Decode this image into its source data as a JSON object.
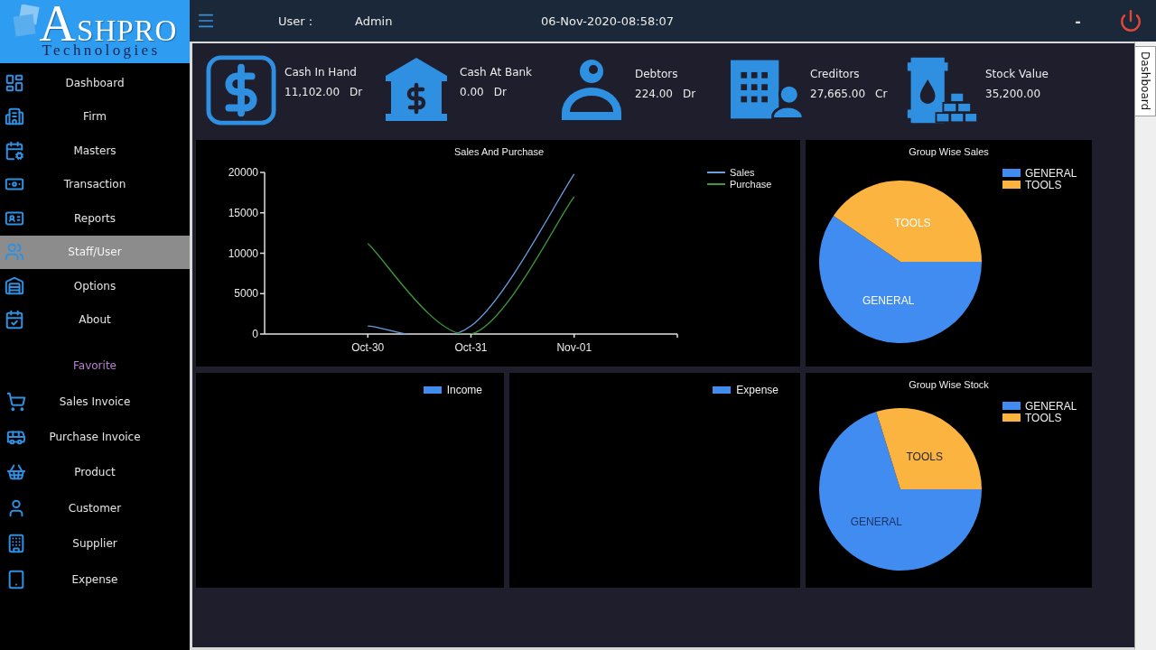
{
  "logo": {
    "title": "ASHPRO",
    "subtitle": "Technologies"
  },
  "sidebar": {
    "items": [
      {
        "label": "Dashboard",
        "selected": false
      },
      {
        "label": "Firm",
        "selected": false
      },
      {
        "label": "Masters",
        "selected": false
      },
      {
        "label": "Transaction",
        "selected": false
      },
      {
        "label": "Reports",
        "selected": false
      },
      {
        "label": "Staff/User",
        "selected": true
      },
      {
        "label": "Options",
        "selected": false
      },
      {
        "label": "About",
        "selected": false
      }
    ],
    "favorites_heading": "Favorite",
    "favorites": [
      {
        "label": "Sales Invoice",
        "selected": false
      },
      {
        "label": "Purchase Invoice",
        "selected": false
      },
      {
        "label": "Product",
        "selected": false
      },
      {
        "label": "Customer",
        "selected": false
      },
      {
        "label": "Supplier",
        "selected": false
      },
      {
        "label": "Expense",
        "selected": false
      }
    ]
  },
  "top_bar": {
    "user_label": "User :",
    "user_name": "Admin",
    "datetime": "06-Nov-2020-08:58:07",
    "minimize": "-"
  },
  "tabs": [
    {
      "label": "Dashboard",
      "selected": true
    }
  ],
  "summary_cards": [
    {
      "label": "Cash In Hand",
      "amount": "11,102.00",
      "balance_type": "Dr"
    },
    {
      "label": "Cash At Bank",
      "amount": "0.00",
      "balance_type": "Dr"
    },
    {
      "label": "Debtors",
      "amount": "224.00",
      "balance_type": "Dr"
    },
    {
      "label": "Creditors",
      "amount": "27,665.00",
      "balance_type": "Cr"
    },
    {
      "label": "Stock Value",
      "amount": "35,200.00"
    }
  ],
  "charts": {
    "sales_purchase": {
      "chart_data": {
        "type": "line",
        "title": "Sales And Purchase",
        "categories": [
          "Oct-30",
          "Oct-31",
          "Nov-01"
        ],
        "series": [
          {
            "name": "Sales",
            "color": "#6b9de0",
            "values": [
              1000,
              1000,
              19800
            ]
          },
          {
            "name": "Purchase",
            "color": "#3c9c3c",
            "values": [
              11200,
              0,
              17000
            ]
          }
        ],
        "ylim": [
          0,
          20000
        ],
        "yticks": [
          0,
          5000,
          10000,
          15000,
          20000
        ],
        "legend": "upper right"
      }
    },
    "group_wise_sales": {
      "chart_data": {
        "type": "pie",
        "title": "Group Wise Sales",
        "categories": [
          "GENERAL",
          "TOOLS"
        ],
        "values": [
          59.6,
          40.4
        ],
        "value_labels": [
          "GENERAL",
          "TOOLS"
        ],
        "legend": "upper right"
      }
    },
    "income": {
      "legend": "Income"
    },
    "expense": {
      "legend": "Expense"
    },
    "group_wise_stock": {
      "chart_data": {
        "type": "pie",
        "title": "Group Wise Stock",
        "categories": [
          "GENERAL",
          "TOOLS"
        ],
        "values": [
          70.2,
          29.8
        ],
        "value_labels": [
          "GENERAL",
          "TOOLS"
        ],
        "legend": "upper right"
      }
    }
  }
}
